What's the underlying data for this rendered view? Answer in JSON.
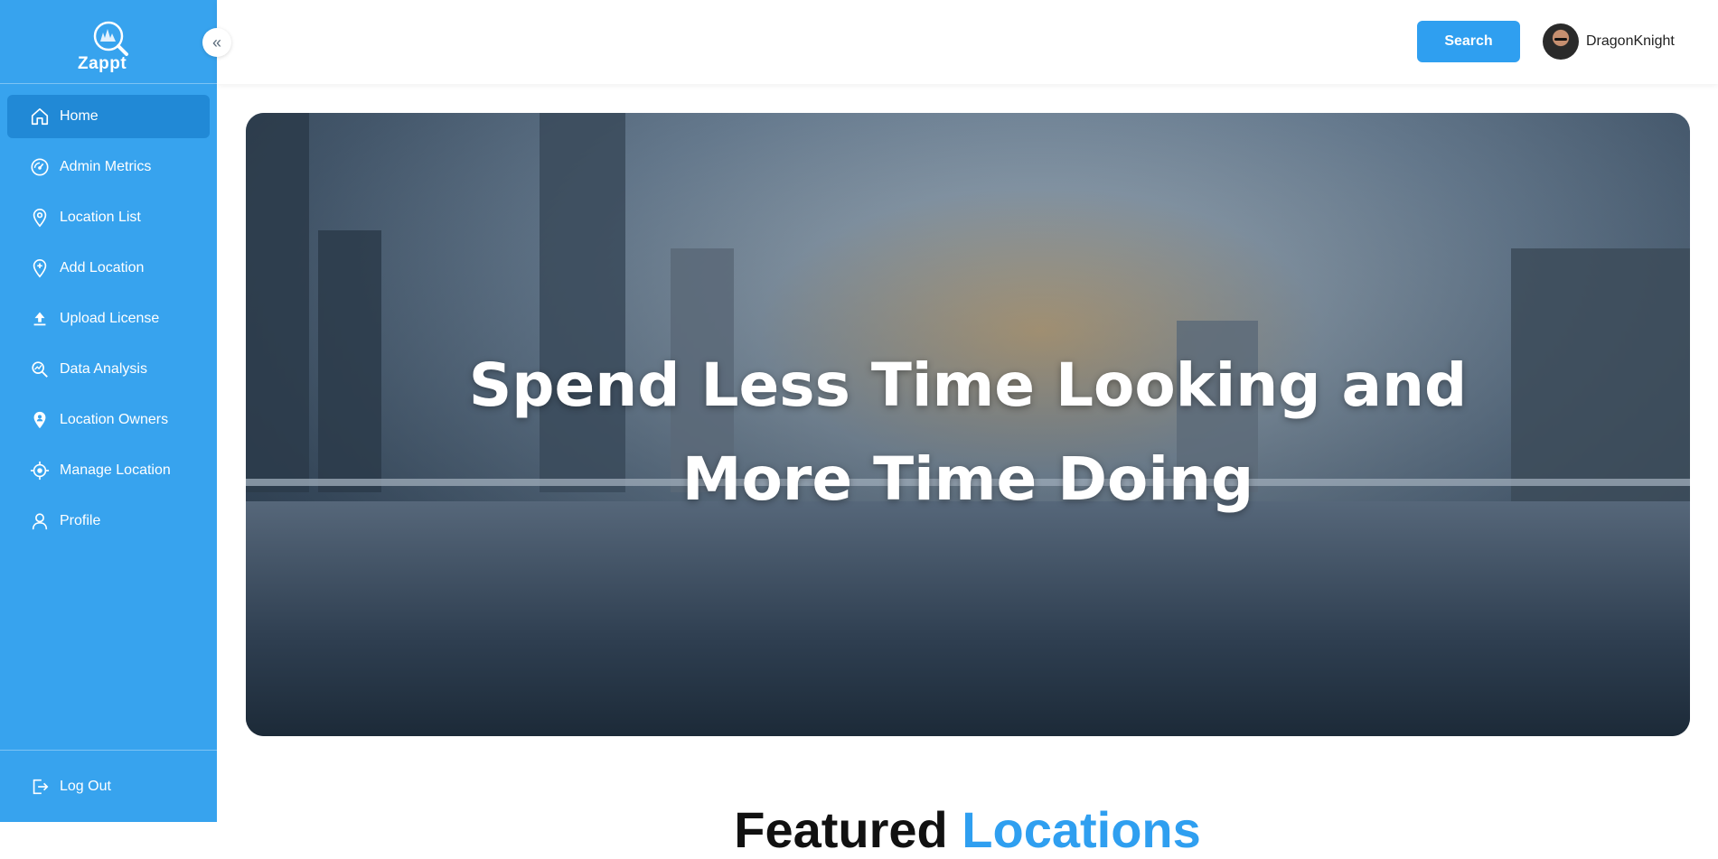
{
  "app": {
    "logo_text": "Zappt"
  },
  "sidebar": {
    "items": [
      {
        "label": "Home",
        "icon": "home-icon",
        "active": true
      },
      {
        "label": "Admin Metrics",
        "icon": "gauge-icon",
        "active": false
      },
      {
        "label": "Location List",
        "icon": "map-pin-icon",
        "active": false
      },
      {
        "label": "Add Location",
        "icon": "add-location-icon",
        "active": false
      },
      {
        "label": "Upload License",
        "icon": "upload-icon",
        "active": false
      },
      {
        "label": "Data Analysis",
        "icon": "analysis-icon",
        "active": false
      },
      {
        "label": "Location Owners",
        "icon": "person-pin-icon",
        "active": false
      },
      {
        "label": "Manage Location",
        "icon": "target-icon",
        "active": false
      },
      {
        "label": "Profile",
        "icon": "user-icon",
        "active": false
      }
    ],
    "logout_label": "Log Out"
  },
  "header": {
    "search_label": "Search",
    "username": "DragonKnight"
  },
  "hero": {
    "title_line1": "Spend Less Time Looking and",
    "title_line2": "More Time Doing"
  },
  "section": {
    "title_part1": "Featured ",
    "title_part2": "Locations"
  },
  "colors": {
    "sidebar": "#37a3ee",
    "active_item": "#2189d6",
    "accent": "#2f9ff0"
  }
}
